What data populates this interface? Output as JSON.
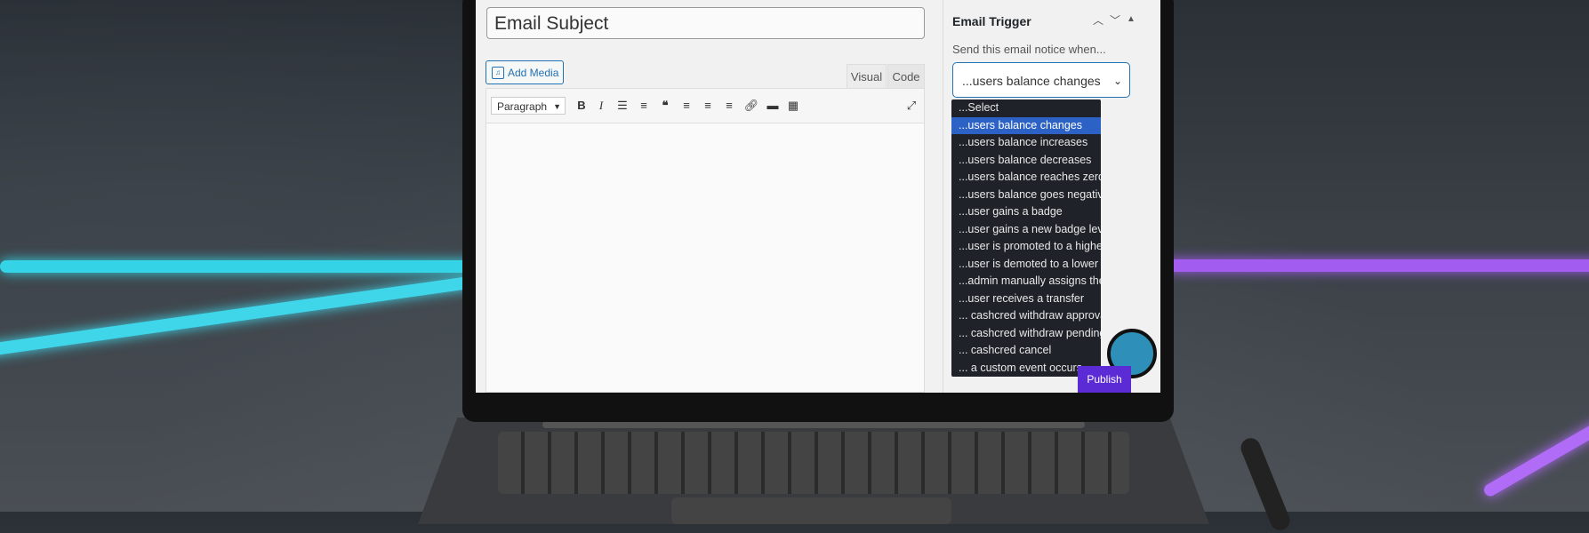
{
  "editor": {
    "subject_placeholder": "Email Subject",
    "add_media_label": "Add Media",
    "tabs": {
      "visual": "Visual",
      "code": "Code"
    },
    "format_select": "Paragraph",
    "toolbar_icons": [
      "bold-icon",
      "italic-icon",
      "bullet-list-icon",
      "numbered-list-icon",
      "blockquote-icon",
      "align-left-icon",
      "align-center-icon",
      "align-right-icon",
      "link-icon",
      "read-more-icon",
      "toolbar-toggle-icon",
      "fullscreen-icon"
    ],
    "toolbar_glyphs": {
      "bold": "B",
      "italic": "I"
    }
  },
  "sidebar": {
    "title": "Email Trigger",
    "description": "Send this email notice when...",
    "selected": "...users balance changes",
    "options": [
      "...Select",
      "...users balance changes",
      "...users balance increases",
      "...users balance decreases",
      "...users balance reaches zero",
      "...users balance goes negative",
      "...user gains a badge",
      "...user gains a new badge level",
      "...user is promoted to a higher rank",
      "...user is demoted to a lower rank",
      "...admin manually assigns the rank",
      "...user receives a transfer",
      "... cashcred withdraw approval",
      "... cashcred withdraw pending",
      "... cashcred cancel",
      "... a custom event occurs"
    ],
    "selected_index": 1,
    "publish_label": "Publish"
  },
  "colors": {
    "accent_blue": "#2271b1",
    "dropdown_bg": "#1f2229",
    "dropdown_selected": "#2c62c6",
    "neon_cyan": "#35d3e6",
    "neon_purple": "#a25cf0",
    "publish_purple": "#5b2bd6"
  }
}
